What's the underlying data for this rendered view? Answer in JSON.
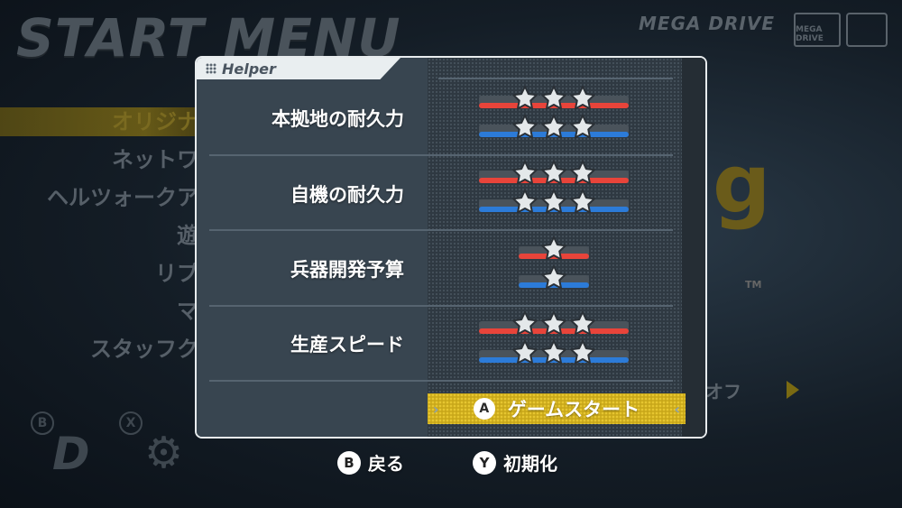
{
  "background": {
    "title": "START MENU",
    "brand": "MEGA DRIVE",
    "md_logo_text": "MEGA DRIVE",
    "menu_items": [
      "オリジナ",
      "ネットワ",
      "ヘルツォークア",
      "遊",
      "リプ",
      "マ",
      "スタッフク"
    ],
    "game_logo_text": "g",
    "tm": "TM",
    "option_text": "オフ",
    "b_label": "B",
    "x_label": "X"
  },
  "modal": {
    "tab_label": "Helper",
    "rows": [
      {
        "label": "本拠地の耐久力",
        "red_stars": 3,
        "blue_stars": 3
      },
      {
        "label": "自機の耐久力",
        "red_stars": 3,
        "blue_stars": 3
      },
      {
        "label": "兵器開発予算",
        "red_stars": 1,
        "blue_stars": 1
      },
      {
        "label": "生産スピード",
        "red_stars": 3,
        "blue_stars": 3
      }
    ],
    "start_button": {
      "key": "A",
      "label": "ゲームスタート"
    }
  },
  "footer": {
    "back": {
      "key": "B",
      "label": "戻る"
    },
    "reset": {
      "key": "Y",
      "label": "初期化"
    }
  },
  "colors": {
    "red_bar": "#e8443a",
    "blue_bar": "#2c7bd8",
    "start_bar": "#c9a81a",
    "star_fill": "#e4e8ea"
  }
}
